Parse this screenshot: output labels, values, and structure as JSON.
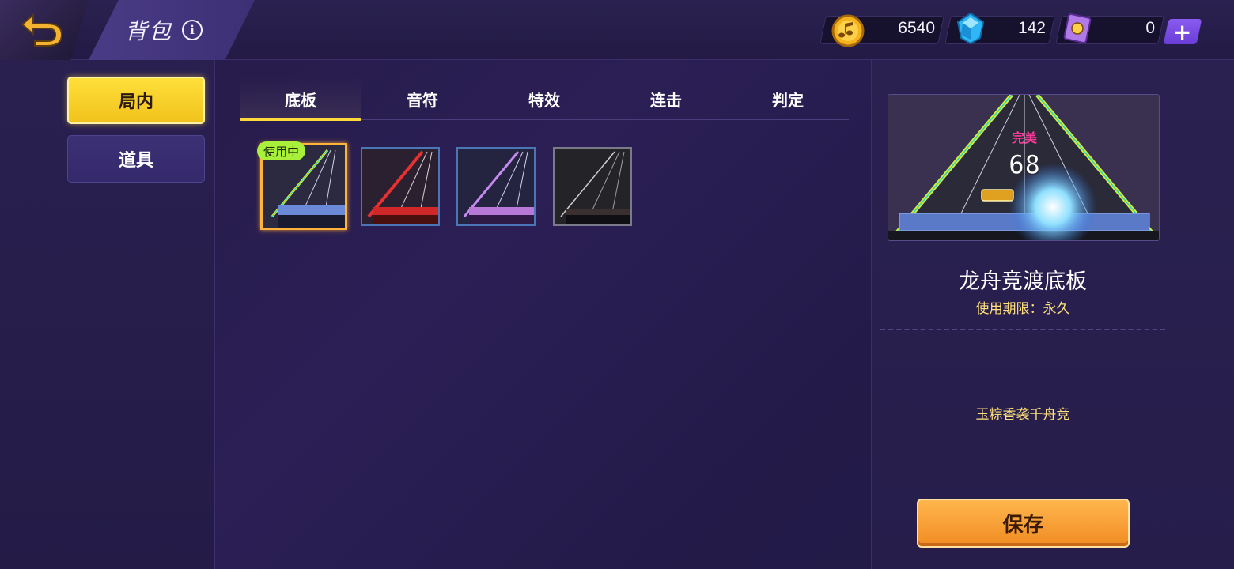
{
  "header": {
    "title": "背包",
    "info_icon": "i"
  },
  "currencies": [
    {
      "name": "gold-note",
      "value": "6540",
      "color": "#f5b41e"
    },
    {
      "name": "diamond",
      "value": "142",
      "color": "#2fb6f5"
    },
    {
      "name": "ticket",
      "value": "0",
      "color": "#b07ae8"
    }
  ],
  "plus_label": "+",
  "sidebar": {
    "items": [
      {
        "label": "局内",
        "active": true
      },
      {
        "label": "道具",
        "active": false
      }
    ]
  },
  "tabs": [
    {
      "label": "底板",
      "active": true
    },
    {
      "label": "音符",
      "active": false
    },
    {
      "label": "特效",
      "active": false
    },
    {
      "label": "连击",
      "active": false
    },
    {
      "label": "判定",
      "active": false
    }
  ],
  "items": [
    {
      "name": "dragon-boat-board",
      "selected": true,
      "badge": "使用中",
      "accent": "#d6f03a"
    },
    {
      "name": "red-board",
      "selected": false,
      "accent": "#e83030"
    },
    {
      "name": "purple-board",
      "selected": false,
      "accent": "#c48af0"
    },
    {
      "name": "dark-board",
      "selected": false,
      "accent": "#d0d0d0"
    }
  ],
  "detail": {
    "preview_judge": "完美",
    "preview_combo": "68",
    "name": "龙舟竞渡底板",
    "duration": "使用期限：永久",
    "description": "玉粽香袭千舟竞",
    "save_label": "保存"
  }
}
